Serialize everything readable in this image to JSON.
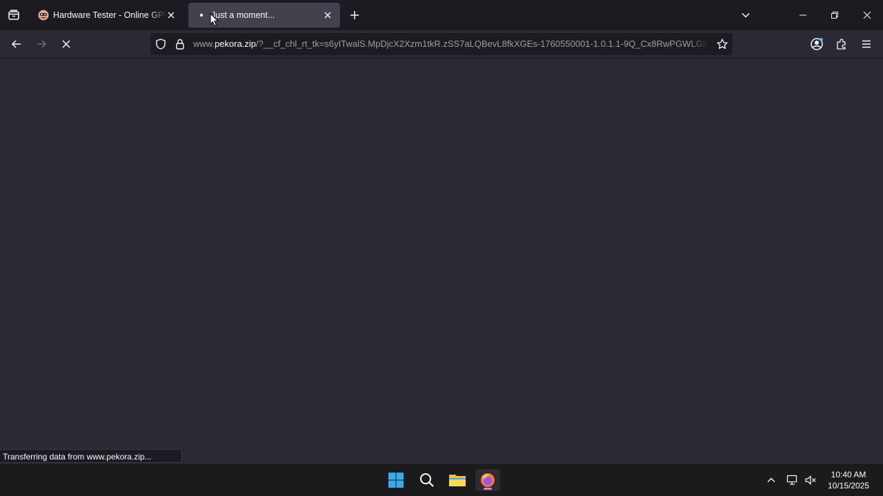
{
  "browser": {
    "tabs": [
      {
        "title": "Hardware Tester - Online GPU Test",
        "favicon": "hardware-tester-favicon",
        "active": false
      },
      {
        "title": "Just a moment...",
        "favicon": "loading-dot",
        "active": true
      }
    ],
    "url": {
      "prefix": "www.",
      "host": "pekora.zip",
      "rest": "/?__cf_chl_rt_tk=s6yITwalS.MpDjcX2Xzm1tkR.zSS7aLQBevL8fkXGEs-1760550001-1.0.1.1-9Q_Cx8RwPGWLGb"
    },
    "status_text": "Transferring data from www.pekora.zip..."
  },
  "taskbar": {
    "apps": [
      "windows-start-icon",
      "search-icon",
      "file-explorer-icon",
      "firefox-icon"
    ],
    "clock": {
      "time": "10:40 AM",
      "date": "10/15/2025"
    }
  },
  "colors": {
    "page_bg": "#2b2a33",
    "tabbar_bg": "#1c1b22",
    "active_tab": "#42414d",
    "accent": "#e27ad8"
  }
}
